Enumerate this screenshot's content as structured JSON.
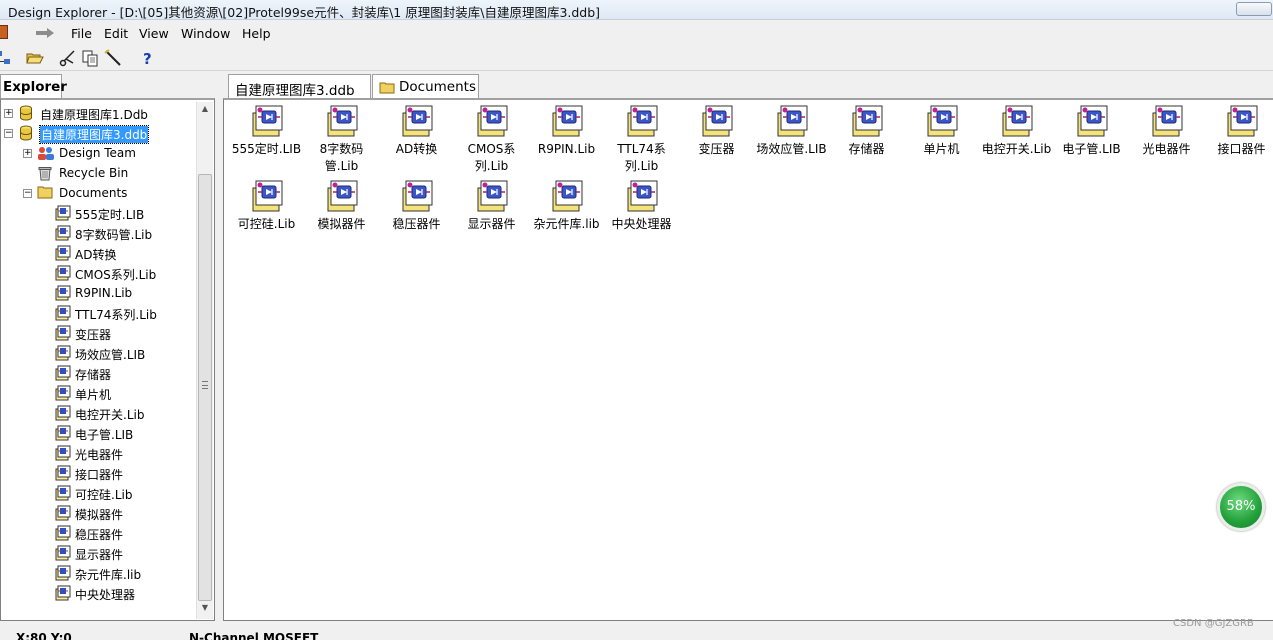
{
  "window": {
    "title": "Design Explorer - [D:\\[05]其他资源\\[02]Protel99se元件、封装库\\1 原理图封装库\\自建原理图库3.ddb]"
  },
  "menu": [
    "File",
    "Edit",
    "View",
    "Window",
    "Help"
  ],
  "toolbar": {
    "icons": [
      "tree-icon",
      "open-folder-icon",
      "scissors-icon",
      "copy-icon",
      "wand-icon",
      "help-icon"
    ],
    "help_glyph": "?"
  },
  "explorer": {
    "tab_label": "Explorer",
    "tree": [
      {
        "label": "自建原理图库1.Ddb",
        "level": 0,
        "type": "database",
        "expander": "+"
      },
      {
        "label": "自建原理图库3.ddb",
        "level": 0,
        "type": "database",
        "expander": "-",
        "selected": true
      },
      {
        "label": "Design Team",
        "level": 1,
        "type": "team",
        "expander": "+"
      },
      {
        "label": "Recycle Bin",
        "level": 1,
        "type": "recycle-bin"
      },
      {
        "label": "Documents",
        "level": 1,
        "type": "folder",
        "expander": "-"
      },
      {
        "label": "555定时.LIB",
        "level": 2,
        "type": "library"
      },
      {
        "label": "8字数码管.Lib",
        "level": 2,
        "type": "library"
      },
      {
        "label": "AD转换",
        "level": 2,
        "type": "library"
      },
      {
        "label": "CMOS系列.Lib",
        "level": 2,
        "type": "library"
      },
      {
        "label": "R9PIN.Lib",
        "level": 2,
        "type": "library"
      },
      {
        "label": "TTL74系列.Lib",
        "level": 2,
        "type": "library"
      },
      {
        "label": "变压器",
        "level": 2,
        "type": "library"
      },
      {
        "label": "场效应管.LIB",
        "level": 2,
        "type": "library"
      },
      {
        "label": "存储器",
        "level": 2,
        "type": "library"
      },
      {
        "label": "单片机",
        "level": 2,
        "type": "library"
      },
      {
        "label": "电控开关.Lib",
        "level": 2,
        "type": "library"
      },
      {
        "label": "电子管.LIB",
        "level": 2,
        "type": "library"
      },
      {
        "label": "光电器件",
        "level": 2,
        "type": "library"
      },
      {
        "label": "接口器件",
        "level": 2,
        "type": "library"
      },
      {
        "label": "可控硅.Lib",
        "level": 2,
        "type": "library"
      },
      {
        "label": "模拟器件",
        "level": 2,
        "type": "library"
      },
      {
        "label": "稳压器件",
        "level": 2,
        "type": "library"
      },
      {
        "label": "显示器件",
        "level": 2,
        "type": "library"
      },
      {
        "label": "杂元件库.lib",
        "level": 2,
        "type": "library"
      },
      {
        "label": "中央处理器",
        "level": 2,
        "type": "library"
      }
    ]
  },
  "content": {
    "tabs": [
      {
        "label": "自建原理图库3.ddb"
      },
      {
        "label": "Documents",
        "icon": "folder-icon"
      }
    ],
    "documents": [
      {
        "name": "555定时.LIB"
      },
      {
        "name": "8字数码管.Lib"
      },
      {
        "name": "AD转换"
      },
      {
        "name": "CMOS系列.Lib"
      },
      {
        "name": "R9PIN.Lib"
      },
      {
        "name": "TTL74系列.Lib"
      },
      {
        "name": "变压器"
      },
      {
        "name": "场效应管.LIB"
      },
      {
        "name": "存储器"
      },
      {
        "name": "单片机"
      },
      {
        "name": "电控开关.Lib"
      },
      {
        "name": "电子管.LIB"
      },
      {
        "name": "光电器件"
      },
      {
        "name": "接口器件"
      },
      {
        "name": "可控硅.Lib"
      },
      {
        "name": "模拟器件"
      },
      {
        "name": "稳压器件"
      },
      {
        "name": "显示器件"
      },
      {
        "name": "杂元件库.lib"
      },
      {
        "name": "中央处理器"
      }
    ]
  },
  "statusbar": {
    "coords": "X:80 Y:0",
    "component": "N-Channel MOSFET"
  },
  "badge": {
    "text": "58%"
  },
  "watermark": "CSDN @GJZGRB"
}
